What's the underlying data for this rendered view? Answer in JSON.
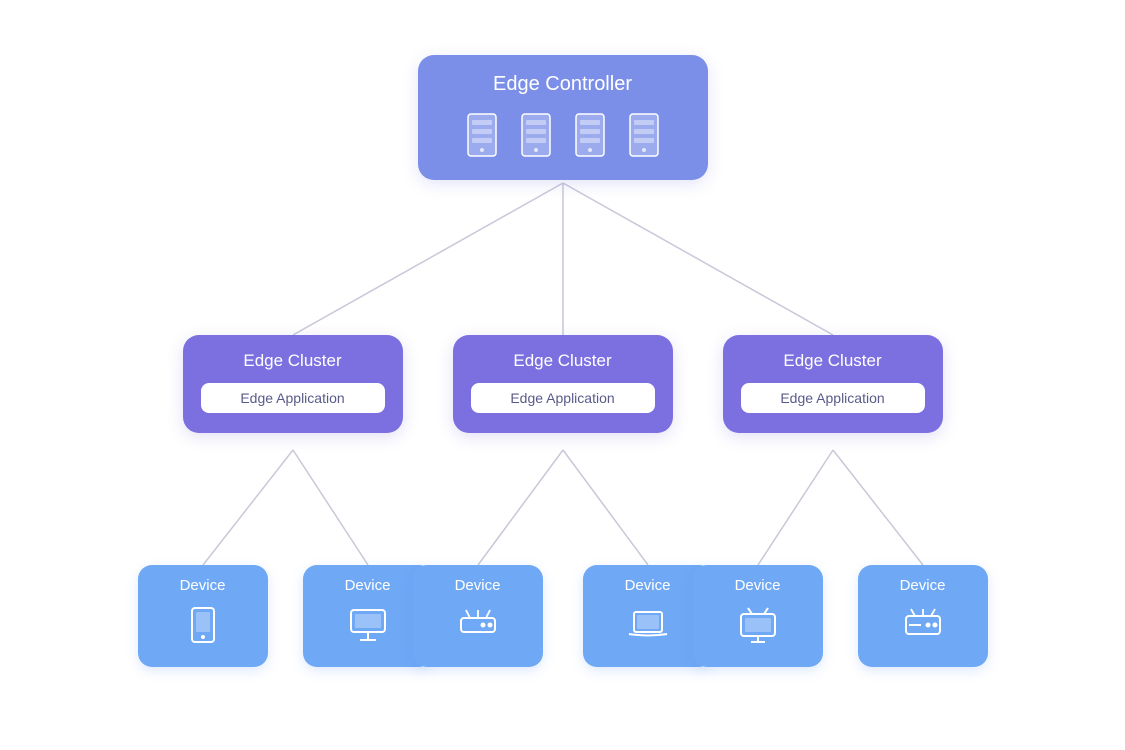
{
  "controller": {
    "title": "Edge Controller",
    "icon_count": 4
  },
  "clusters": [
    {
      "id": "cluster-left",
      "title": "Edge Cluster",
      "app_label": "Edge Application"
    },
    {
      "id": "cluster-center",
      "title": "Edge Cluster",
      "app_label": "Edge Application"
    },
    {
      "id": "cluster-right",
      "title": "Edge Cluster",
      "app_label": "Edge Application"
    }
  ],
  "devices": [
    {
      "id": "dev-ll",
      "title": "Device",
      "icon": "tablet"
    },
    {
      "id": "dev-lr",
      "title": "Device",
      "icon": "monitor"
    },
    {
      "id": "dev-cl",
      "title": "Device",
      "icon": "server-drive"
    },
    {
      "id": "dev-cr",
      "title": "Device",
      "icon": "laptop"
    },
    {
      "id": "dev-rl",
      "title": "Device",
      "icon": "tv"
    },
    {
      "id": "dev-rr",
      "title": "Device",
      "icon": "server-drive2"
    }
  ],
  "colors": {
    "controller_bg": "#7b8fe8",
    "cluster_bg": "#7c6fe0",
    "device_bg": "#6fa8f5",
    "connector": "#c8c8d8",
    "app_badge_text": "#5a5a8a",
    "white": "#ffffff"
  }
}
